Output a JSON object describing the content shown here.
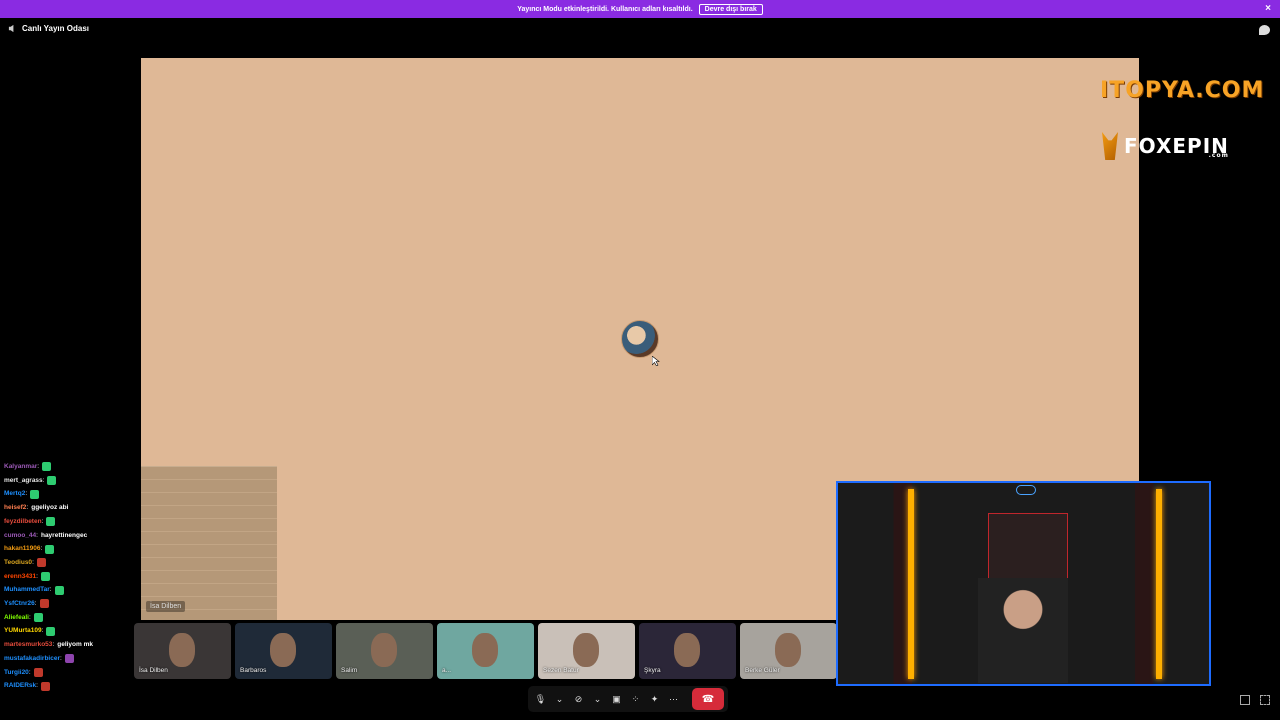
{
  "banner": {
    "text": "Yayıncı Modu etkinleştirildi. Kullanıcı adları kısaltıldı.",
    "button_label": "Devre dışı bırak",
    "close": "×"
  },
  "topbar": {
    "title": "Canlı Yayın Odası",
    "icon": "speaker-icon"
  },
  "stage": {
    "speaker_tag": "İsa Dilben",
    "color": "#dfb896"
  },
  "logos": {
    "itopya": "ITOPYA.COM",
    "foxepin": "FOXEPIN",
    "foxepin_com": ".com"
  },
  "chat": [
    {
      "user": "Kalyanmar",
      "sep": " :",
      "msg": "",
      "color": "#9b59b6",
      "emote": "#2ecc71"
    },
    {
      "user": "mert_agrass",
      "sep": " :",
      "msg": "",
      "color": "#e8e8e8",
      "emote": "#2ecc71"
    },
    {
      "user": "Mertq2",
      "sep": " :",
      "msg": "",
      "color": "#1e90ff",
      "emote": "#2ecc71"
    },
    {
      "user": "heisef2",
      "sep": " :",
      "msg": "ggeliyoz abi",
      "color": "#ff7f50",
      "emote": ""
    },
    {
      "user": "feyzdilbeten",
      "sep": " :",
      "msg": "",
      "color": "#e74c3c",
      "emote": "#2ecc71"
    },
    {
      "user": "cumoo_44",
      "sep": " :",
      "msg": "hayrettinengec",
      "color": "#9b59b6",
      "emote": ""
    },
    {
      "user": "hakan11906",
      "sep": " :",
      "msg": "",
      "color": "#f39c12",
      "emote": "#2ecc71"
    },
    {
      "user": "Teodius0",
      "sep": " :",
      "msg": "",
      "color": "#daa520",
      "emote": "#c0392b"
    },
    {
      "user": "erenn3431",
      "sep": " :",
      "msg": "",
      "color": "#ff4500",
      "emote": "#2ecc71"
    },
    {
      "user": "MuhammedTar",
      "sep": " :",
      "msg": "",
      "color": "#1e90ff",
      "emote": "#2ecc71"
    },
    {
      "user": "YsfCtnr26",
      "sep": " :",
      "msg": "",
      "color": "#1e90ff",
      "emote": "#c0392b"
    },
    {
      "user": "Aliefeali",
      "sep": " :",
      "msg": "",
      "color": "#7fff00",
      "emote": "#2ecc71"
    },
    {
      "user": "YUMurta109",
      "sep": " :",
      "msg": "",
      "color": "#ffd700",
      "emote": "#2ecc71"
    },
    {
      "user": "martesmurko53",
      "sep": " :",
      "msg": "geliyom mk",
      "color": "#e74c3c",
      "emote": ""
    },
    {
      "user": "mustafakadirbicer",
      "sep": " :",
      "msg": "",
      "color": "#1e90ff",
      "emote": "#8e44ad"
    },
    {
      "user": "Turgii20",
      "sep": " :",
      "msg": "",
      "color": "#1e90ff",
      "emote": "#c0392b"
    },
    {
      "user": "RAIDERsk",
      "sep": " :",
      "msg": "",
      "color": "#1e90ff",
      "emote": "#c0392b"
    }
  ],
  "participants": [
    {
      "name": "İsa Dilben",
      "bg": "#3a3636"
    },
    {
      "name": "Barbaros",
      "bg": "#1f2a38"
    },
    {
      "name": "Salim",
      "bg": "#5a5f56"
    },
    {
      "name": "a...",
      "bg": "#6fa7a0"
    },
    {
      "name": "Sezen Batur",
      "bg": "#c9c0b8"
    },
    {
      "name": "Şkyra",
      "bg": "#2b2638"
    },
    {
      "name": "Berke Güler",
      "bg": "#a7a39d"
    }
  ],
  "controls": [
    "mic-icon",
    "chevron-down-icon",
    "camera-off-icon",
    "chevron-down-icon",
    "screen-share-icon",
    "grid-icon",
    "reactions-icon",
    "more-icon"
  ],
  "accent": "#8a2be2",
  "end_call_color": "#d62b3a"
}
